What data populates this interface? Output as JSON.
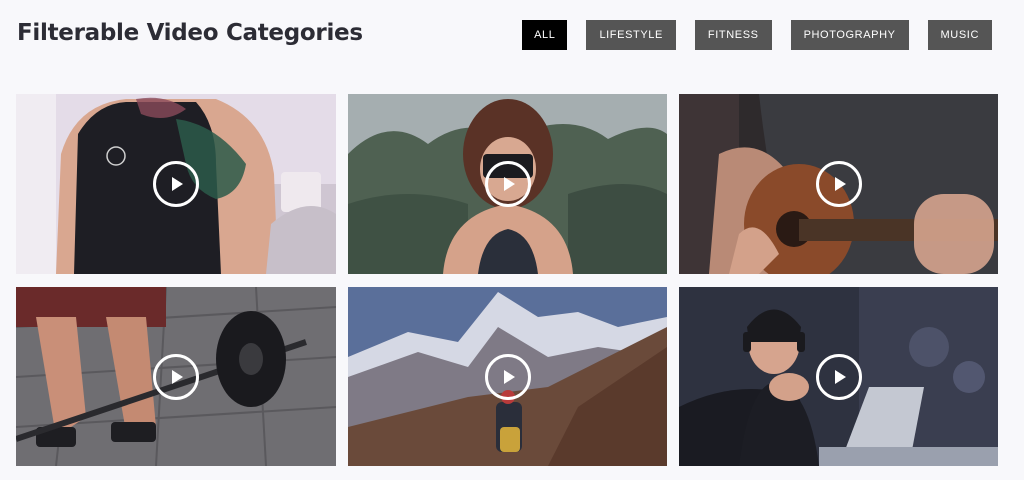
{
  "page": {
    "title": "Filterable Video Categories"
  },
  "filters": [
    {
      "label": "ALL",
      "active": true
    },
    {
      "label": "LIFESTYLE",
      "active": false
    },
    {
      "label": "FITNESS",
      "active": false
    },
    {
      "label": "PHOTOGRAPHY",
      "active": false
    },
    {
      "label": "MUSIC",
      "active": false
    }
  ],
  "videos": [
    {
      "scene": "tattooed woman with mug"
    },
    {
      "scene": "woman holding camera"
    },
    {
      "scene": "man playing acoustic guitar"
    },
    {
      "scene": "weightlifter with barbell"
    },
    {
      "scene": "hiker facing snowy mountains"
    },
    {
      "scene": "man with headphones at laptop"
    }
  ],
  "icons": {
    "play": "play-icon"
  },
  "colors": {
    "filter_active": "#000000",
    "filter_default": "#555555",
    "title": "#2c2c35"
  }
}
